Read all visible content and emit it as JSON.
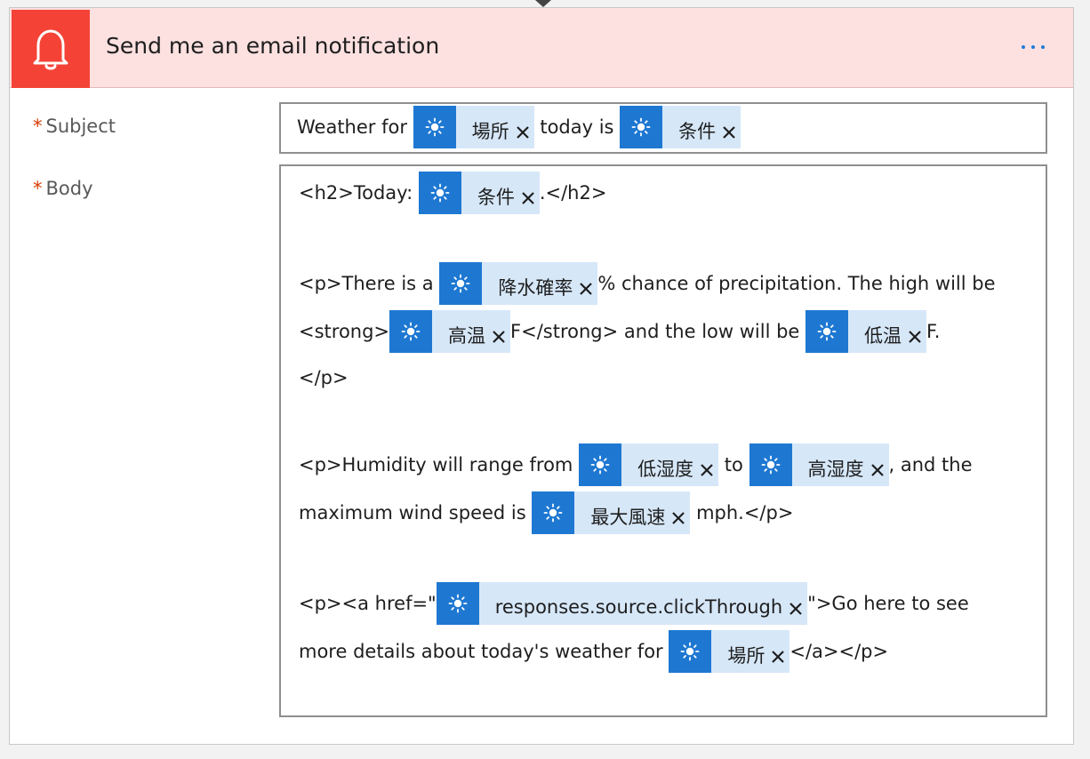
{
  "action": {
    "title": "Send me an email notification",
    "icon": "bell-icon",
    "more_icon": "more-options-icon",
    "accent_color": "#f44336",
    "header_bg": "#fde0e0"
  },
  "fields": {
    "subject": {
      "required_mark": "*",
      "label": "Subject"
    },
    "body": {
      "required_mark": "*",
      "label": "Body"
    }
  },
  "subject_content": {
    "t1": "Weather for ",
    "token_location": "場所",
    "t2": " today is ",
    "token_condition": "条件"
  },
  "body_content": {
    "l1_t1": "<h2>Today: ",
    "l1_token": "条件",
    "l1_t2": ".</h2>",
    "l2_t1": "<p>There is a ",
    "l2_token": "降水確率",
    "l2_t2": "% chance of precipitation. The high will be",
    "l3_t1": "<strong>",
    "l3_token1": "高温",
    "l3_t2": "F</strong> and the low will be ",
    "l3_token2": "低温",
    "l3_t3": "F.",
    "l4_t1": "</p>",
    "l5_t1": "<p>Humidity will range from ",
    "l5_token1": "低湿度",
    "l5_t2": " to ",
    "l5_token2": "高湿度",
    "l5_t3": ", and the",
    "l6_t1": "maximum wind speed is ",
    "l6_token": "最大風速",
    "l6_t2": " mph.</p>",
    "l7_t1": "<p><a href=\"",
    "l7_token": "responses.source.clickThrough",
    "l7_t2": "\">Go here to see",
    "l8_t1": "more details about today's weather for ",
    "l8_token": "場所",
    "l8_t2": "</a></p>"
  },
  "token_icon": "sun-icon",
  "token_remove_icon": "close-icon"
}
